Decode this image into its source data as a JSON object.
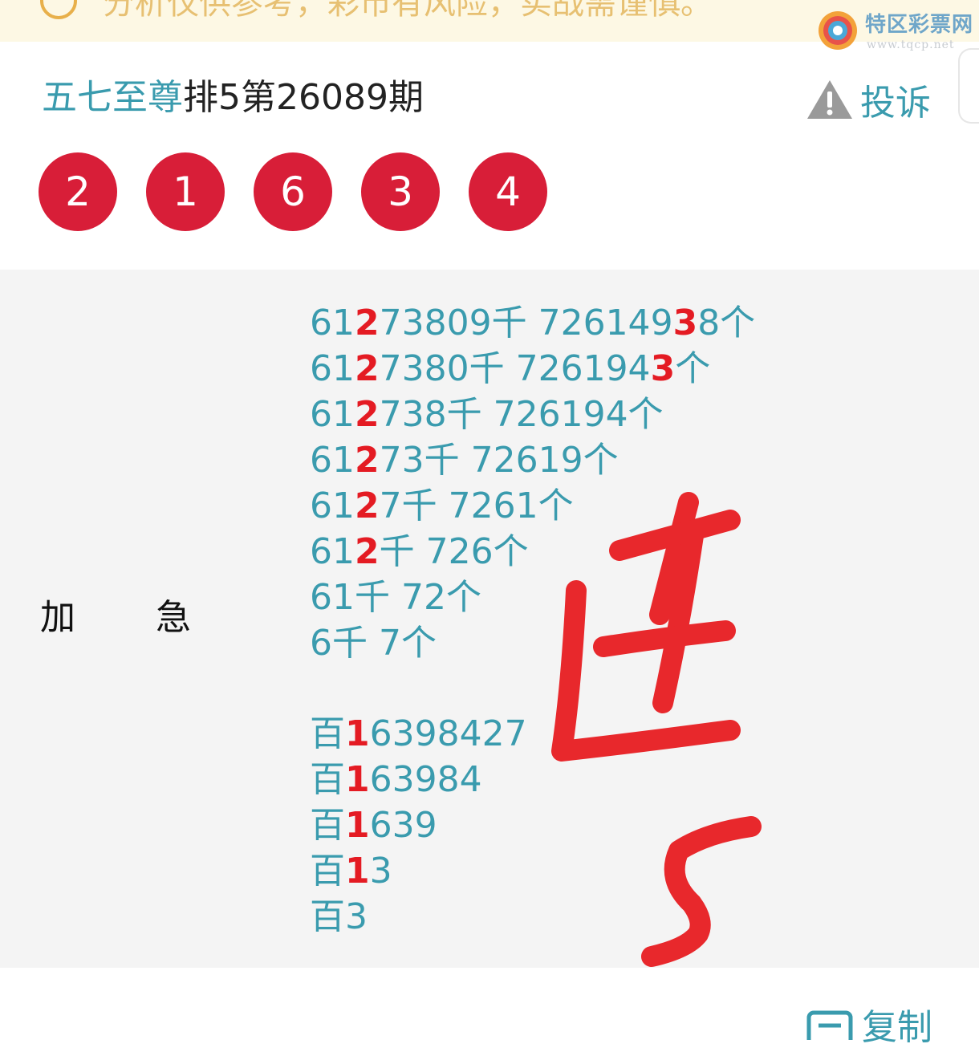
{
  "notice": {
    "text": "分析仅供参考，彩市有风险，实战需谨慎。",
    "icon": "info-icon"
  },
  "watermark": {
    "name": "特区彩票网",
    "url": "www.tqcp.net"
  },
  "header": {
    "author": "五七至尊",
    "title_rest": "排5第26089期",
    "complain_label": "投诉",
    "complain_icon": "warning-icon"
  },
  "balls": [
    "2",
    "1",
    "6",
    "3",
    "4"
  ],
  "content": {
    "label_a": "加",
    "label_b": "急",
    "lines": [
      [
        [
          "61",
          ""
        ],
        [
          "2",
          "hl"
        ],
        [
          "73809千 72614",
          ""
        ],
        [
          "9",
          ""
        ],
        [
          "3",
          "hl"
        ],
        [
          "8个",
          ""
        ]
      ],
      [
        [
          "61",
          ""
        ],
        [
          "2",
          "hl"
        ],
        [
          "7380千 726194",
          ""
        ],
        [
          "3",
          "hl"
        ],
        [
          "个",
          ""
        ]
      ],
      [
        [
          "61",
          ""
        ],
        [
          "2",
          "hl"
        ],
        [
          "738千 726194个",
          ""
        ]
      ],
      [
        [
          "61",
          ""
        ],
        [
          "2",
          "hl"
        ],
        [
          "73千 72619个",
          ""
        ]
      ],
      [
        [
          "61",
          ""
        ],
        [
          "2",
          "hl"
        ],
        [
          "7千 7261个",
          ""
        ]
      ],
      [
        [
          "61",
          ""
        ],
        [
          "2",
          "hl"
        ],
        [
          "千 726个",
          ""
        ]
      ],
      [
        [
          "61千 72个",
          ""
        ]
      ],
      [
        [
          "6千 7个",
          ""
        ]
      ],
      [],
      [
        [
          "百",
          ""
        ],
        [
          "1",
          "hl"
        ],
        [
          "6398427",
          ""
        ]
      ],
      [
        [
          "百",
          ""
        ],
        [
          "1",
          "hl"
        ],
        [
          "63984",
          ""
        ]
      ],
      [
        [
          "百",
          ""
        ],
        [
          "1",
          "hl"
        ],
        [
          "639",
          ""
        ]
      ],
      [
        [
          "百",
          ""
        ],
        [
          "1",
          "hl"
        ],
        [
          "3",
          ""
        ]
      ],
      [
        [
          "百3",
          ""
        ]
      ]
    ]
  },
  "footer": {
    "copy_label": "复制",
    "copy_icon": "copy-icon"
  },
  "colors": {
    "accent": "#3a9bae",
    "ball": "#d81e38",
    "highlight": "#e41b23",
    "handwriting": "#e8282c"
  }
}
